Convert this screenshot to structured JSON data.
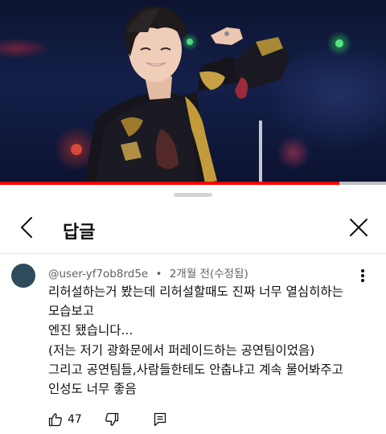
{
  "video": {
    "progress_fraction": 0.88,
    "accent_color": "#ff0000"
  },
  "sheet": {
    "title": "답글",
    "back_icon": "chevron-left-icon",
    "close_icon": "close-icon"
  },
  "comment": {
    "author": "@user-yf7ob8rd5e",
    "separator": "•",
    "time": "2개월 전",
    "edited": "(수정됨)",
    "lines": [
      "리허설하는거 봤는데 리허설할때도 진짜 너무 열심히하는",
      "모습보고",
      "엔진 됐습니다...",
      "(저는 저기 광화문에서 퍼레이드하는 공연팀이었음)",
      "그리고 공연팀들,사람들한테도 안춥냐고 계속 물어봐주고",
      "인성도 너무 좋음"
    ],
    "like_count": "47",
    "icons": {
      "like": "thumbs-up-icon",
      "dislike": "thumbs-down-icon",
      "reply": "reply-icon",
      "more": "more-vertical-icon"
    }
  }
}
